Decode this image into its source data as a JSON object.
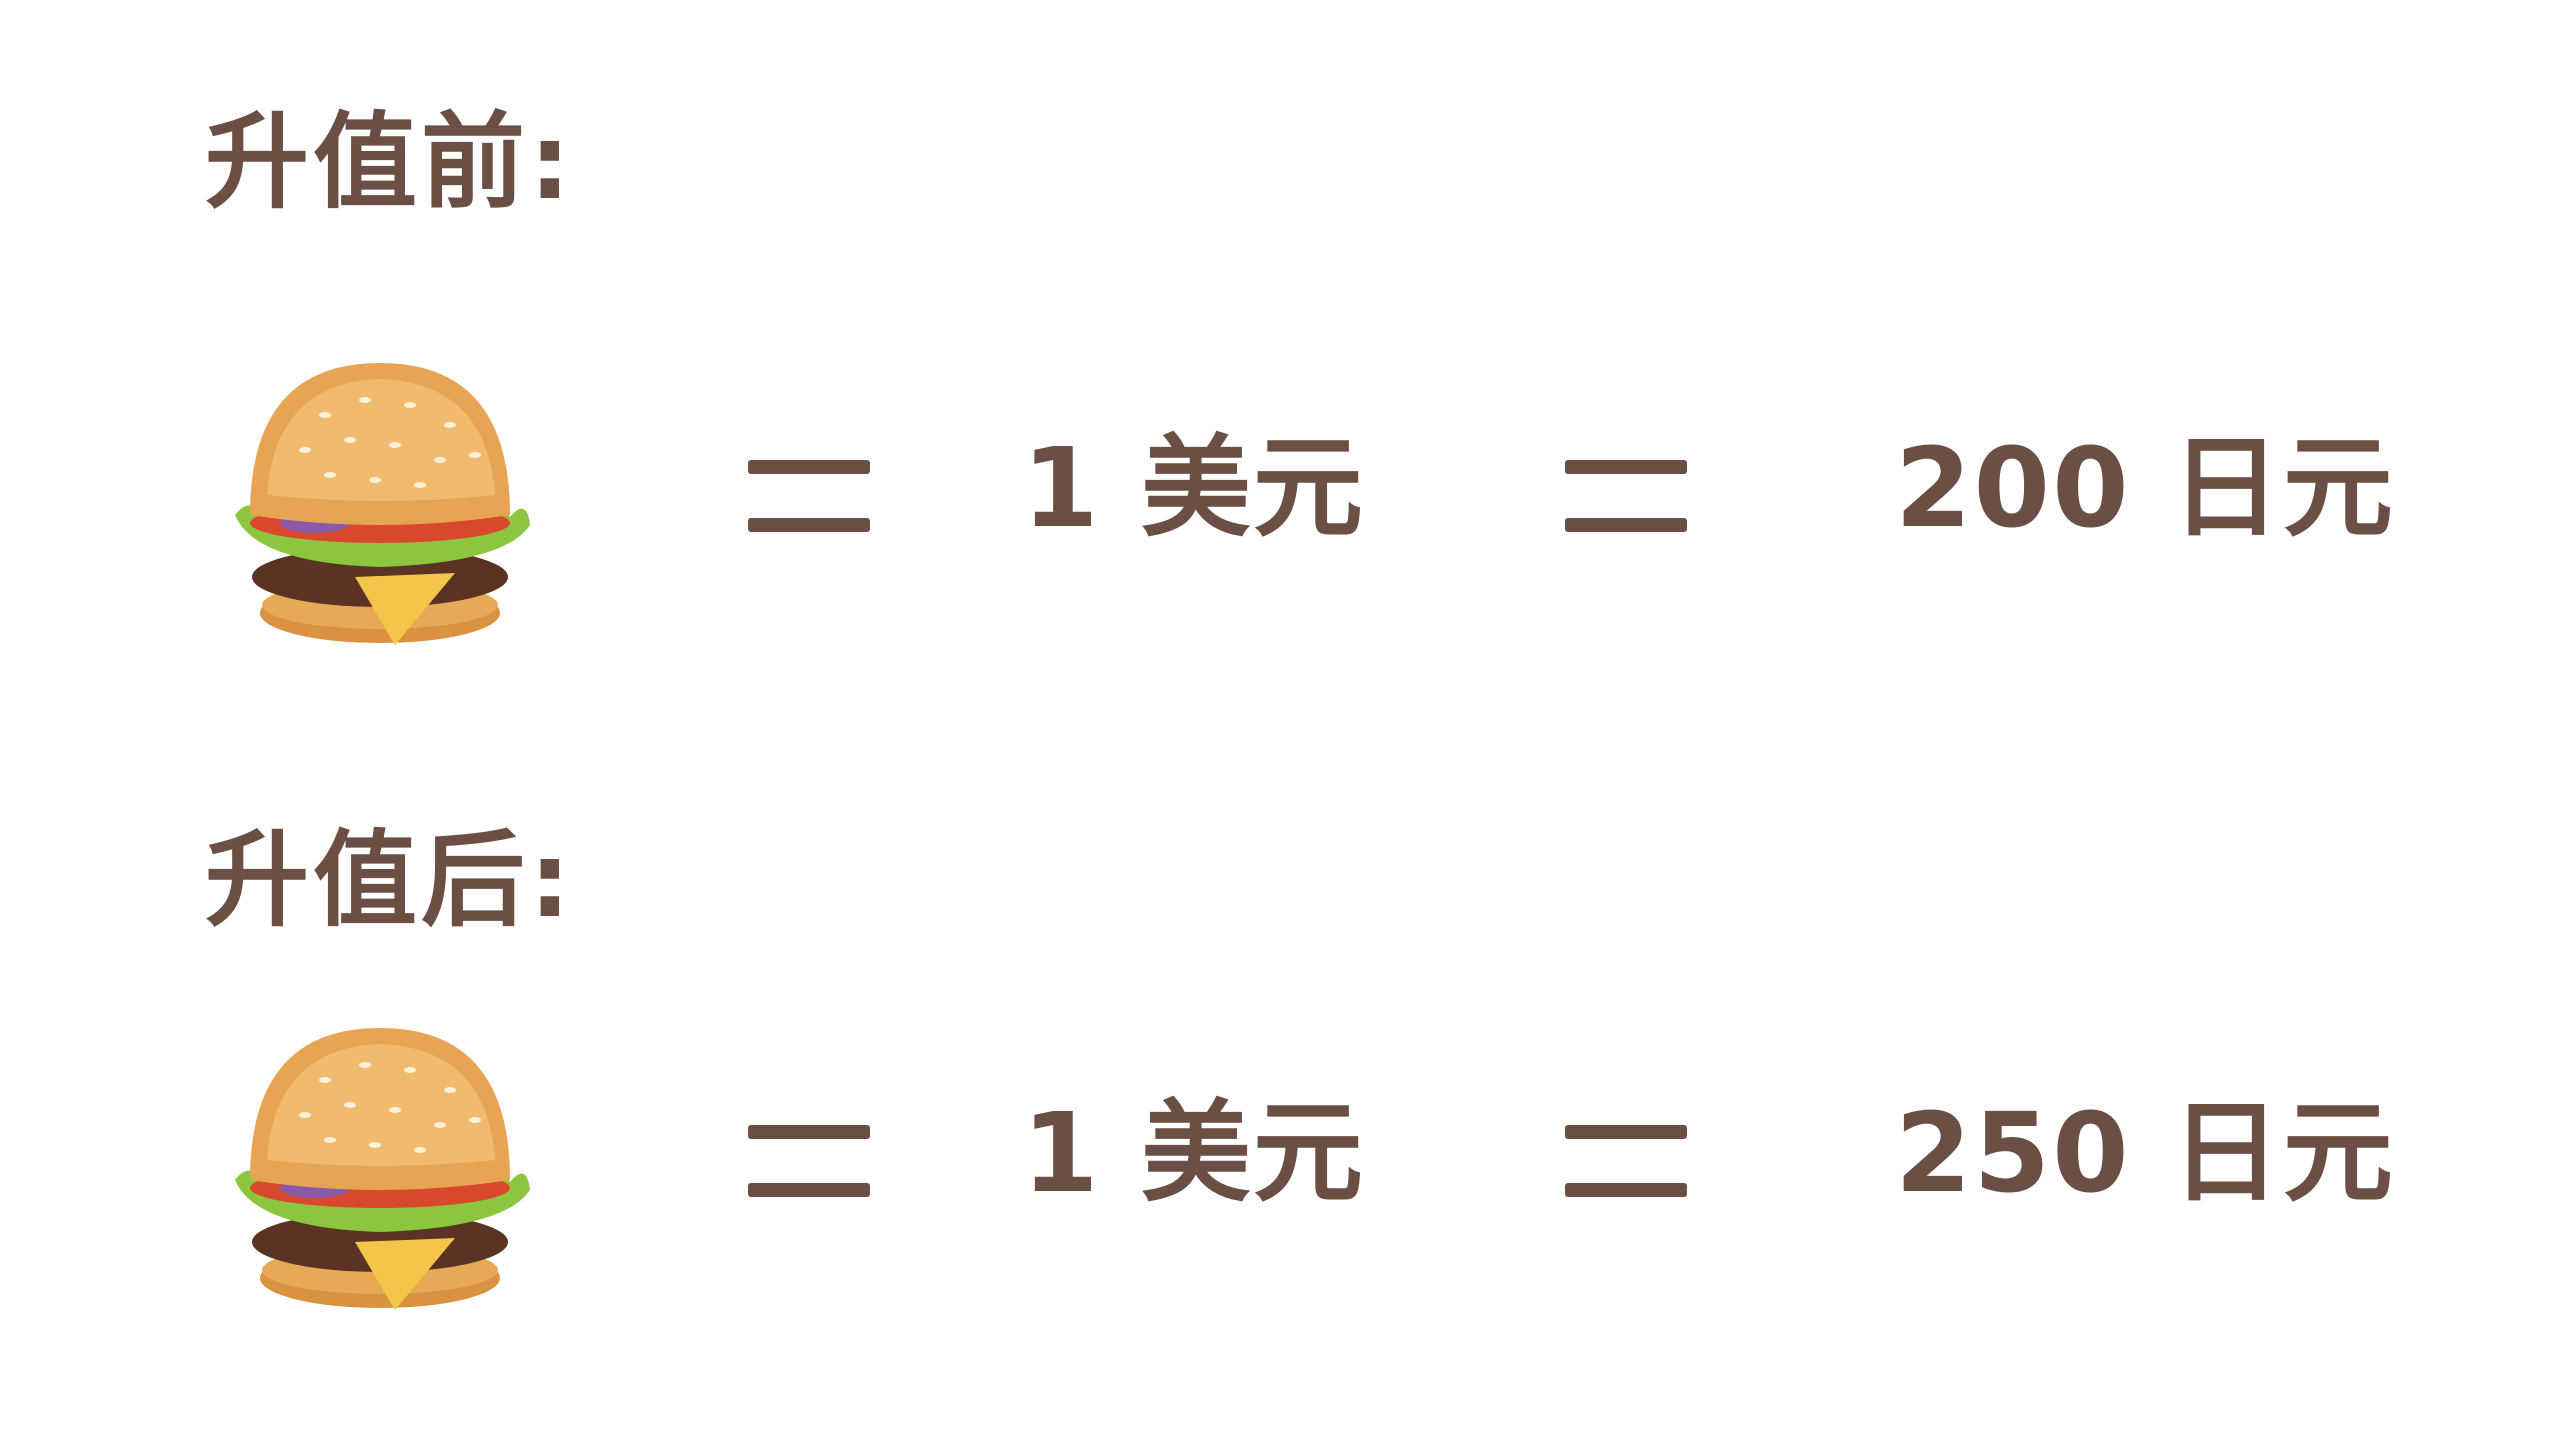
{
  "before": {
    "label": "升值前:",
    "usd_text": "1 美元",
    "jpy_text": "200 日元"
  },
  "after": {
    "label": "升值后:",
    "usd_text": "1 美元",
    "jpy_text": "250 日元"
  },
  "icons": {
    "item": "hamburger-icon",
    "equals": "equals-icon"
  },
  "colors": {
    "text": "#6b4f45",
    "background": "#ffffff"
  }
}
